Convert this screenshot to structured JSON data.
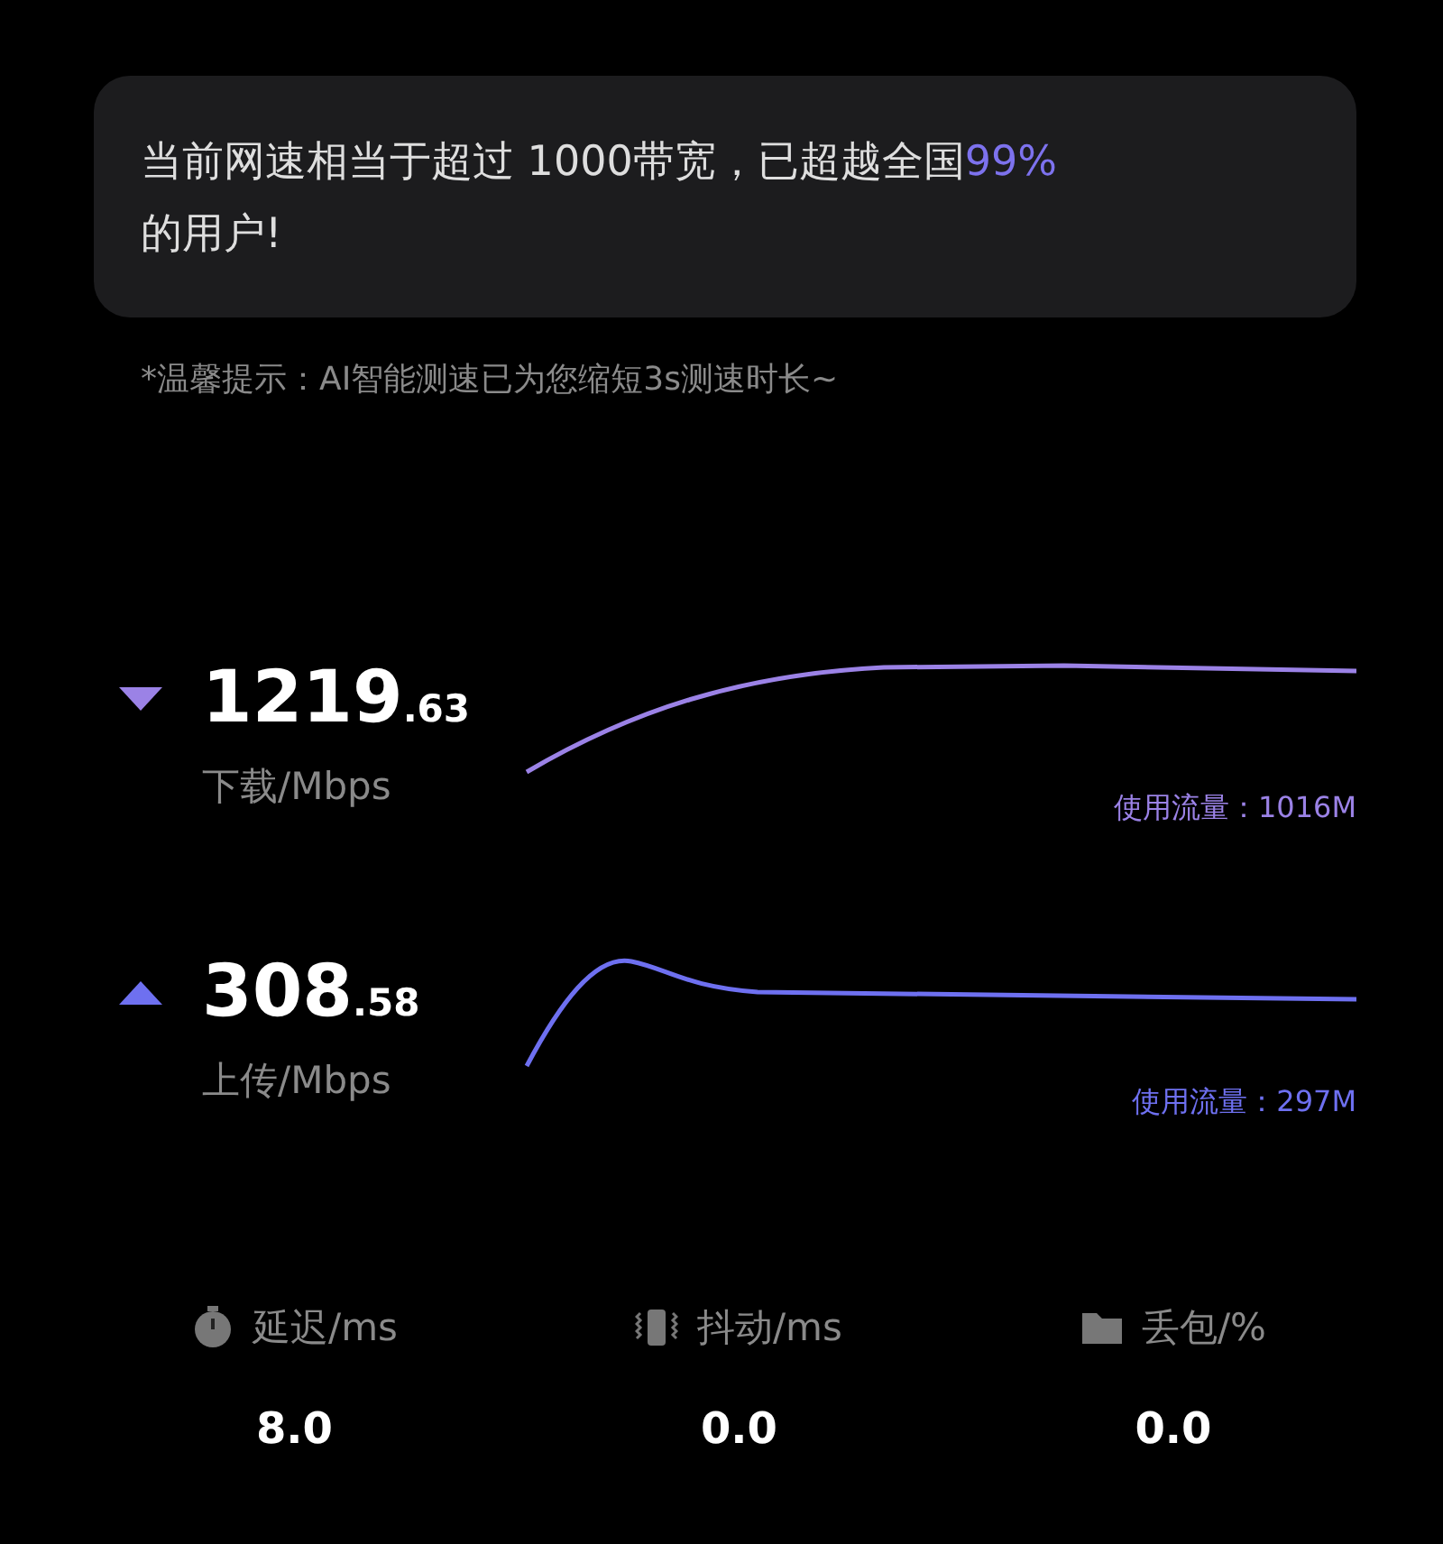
{
  "summary": {
    "before": "当前网速相当于超过 1000带宽，已超越全国",
    "highlight": "99%",
    "after": "的用户!"
  },
  "tip": "*温馨提示：AI智能测速已为您缩短3s测速时长~",
  "tests": [
    {
      "kind": "download",
      "color": "#9b82e6",
      "value_int": "1219",
      "value_dec": ".63",
      "unit": "下载/Mbps",
      "traffic": "使用流量：1016M"
    },
    {
      "kind": "upload",
      "color": "#6e70f0",
      "value_int": "308",
      "value_dec": ".58",
      "unit": "上传/Mbps",
      "traffic": "使用流量：297M"
    }
  ],
  "metrics": [
    {
      "kind": "latency",
      "label": "延迟/ms",
      "value": "8.0"
    },
    {
      "kind": "jitter",
      "label": "抖动/ms",
      "value": "0.0"
    },
    {
      "kind": "loss",
      "label": "丢包/%",
      "value": "0.0"
    }
  ]
}
